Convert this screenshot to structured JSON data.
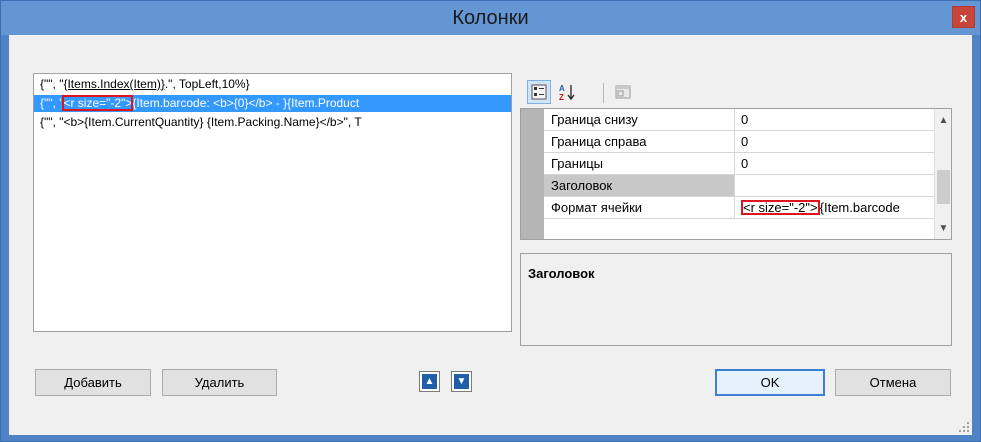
{
  "window": {
    "title": "Колонки",
    "close_glyph": "x"
  },
  "list": {
    "items": [
      {
        "prefix": "{\"\", \"",
        "link_text": "{Items.Index(Item)}",
        "suffix": ".\", TopLeft,10%}"
      },
      {
        "prefix": "{\"\", \"",
        "highlight": "<r size=\"-2\">",
        "rest": "{Item.barcode: <b>{0}</b> - }{Item.Product"
      },
      {
        "text": "{\"\", \"<b>{Item.CurrentQuantity} {Item.Packing.Name}</b>\", T"
      }
    ]
  },
  "toolbar": {
    "icons": [
      "categorized-icon",
      "sort-alphabetical-icon",
      "property-pages-icon"
    ],
    "sort_glyph": "A↓Z"
  },
  "property_grid": {
    "rows": [
      {
        "name": "Граница снизу",
        "value": "0"
      },
      {
        "name": "Граница справа",
        "value": "0"
      },
      {
        "name": "Границы",
        "value": "0"
      },
      {
        "name": "Заголовок",
        "value": ""
      },
      {
        "name": "Формат ячейки",
        "value_highlight": "<r size=\"-2\">",
        "value_rest": "{Item.barcode"
      }
    ]
  },
  "description": {
    "title": "Заголовок"
  },
  "buttons": {
    "add": "Добавить",
    "delete": "Удалить",
    "ok": "OK",
    "cancel": "Отмена"
  },
  "colors": {
    "title_bar": "#6396d3",
    "close": "#c7453a",
    "selection": "#3399ff",
    "highlight_outline": "#e0141e"
  }
}
